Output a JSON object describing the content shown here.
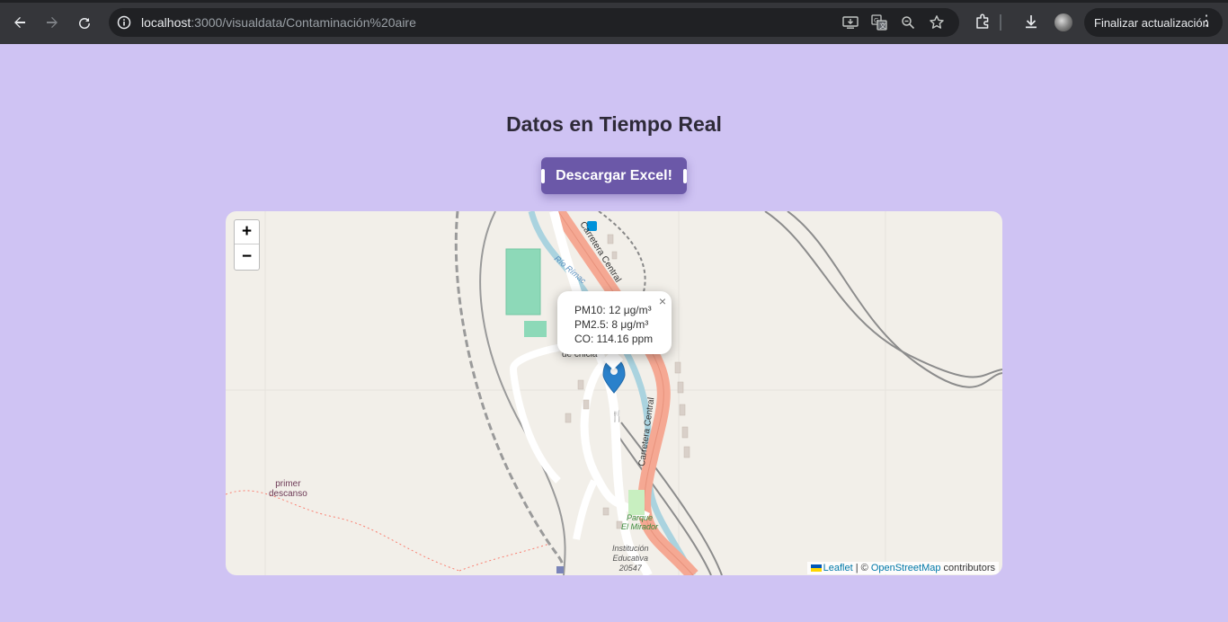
{
  "browser": {
    "url_host": "localhost",
    "url_path": ":3000/visualdata/Contaminación%20aire",
    "update_button": "Finalizar actualización",
    "icons": [
      "back-arrow-icon",
      "forward-arrow-icon",
      "reload-icon",
      "site-info-icon",
      "install-app-icon",
      "translate-icon",
      "zoom-icon",
      "bookmark-star-icon",
      "extensions-icon",
      "downloads-icon",
      "profile-avatar",
      "more-options-icon"
    ]
  },
  "page": {
    "title": "Datos en Tiempo Real",
    "download_button": "Descargar Excel!"
  },
  "map": {
    "zoom_in": "+",
    "zoom_out": "−",
    "popup": {
      "pm10": "PM10: 12 μg/m³",
      "pm25": "PM2.5: 8 μg/m³",
      "co": "CO: 114.16 ppm",
      "close": "×"
    },
    "labels": {
      "road1": "Carretera Central",
      "road2": "Carretera Central",
      "river": "Río Rímac",
      "place1_line1": "primer",
      "place1_line2": "descanso",
      "park_line1": "Parque",
      "park_line2": "El Mirador",
      "school_line1": "Institución",
      "school_line2": "Educativa",
      "school_line3": "20547",
      "partial": "de chicla"
    },
    "attribution": {
      "leaflet": "Leaflet",
      "sep": " | © ",
      "osm": "OpenStreetMap",
      "contributors": " contributors"
    }
  }
}
